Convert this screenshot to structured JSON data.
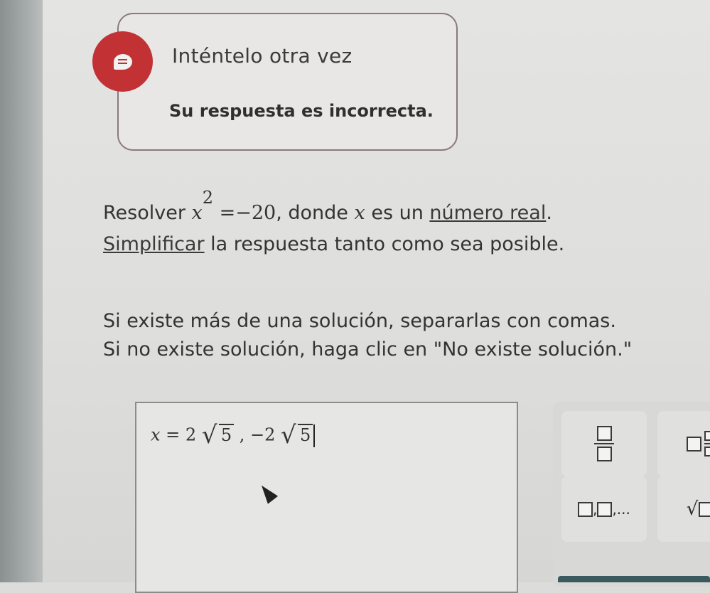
{
  "feedback": {
    "title": "Inténtelo otra vez",
    "message": "Su respuesta es incorrecta."
  },
  "problem": {
    "lead": "Resolver ",
    "var": "x",
    "exponent": "2",
    "equation_rest": " =−20",
    "after": ", donde ",
    "var2": "x",
    "mid": " es un ",
    "link1": "número real",
    "end1": ".",
    "link2": "Simplificar",
    "line2_rest": " la respuesta tanto como sea posible."
  },
  "instructions": {
    "line1": "Si existe más de una solución, separarlas con comas.",
    "line2": "Si no existe solución, haga clic en \"No existe solución.\""
  },
  "answer": {
    "var": "x",
    "equals": " = 2",
    "radicand1": "5",
    "separator": " , −2",
    "radicand2": "5"
  },
  "keypad": {
    "list_suffix": ",..."
  }
}
